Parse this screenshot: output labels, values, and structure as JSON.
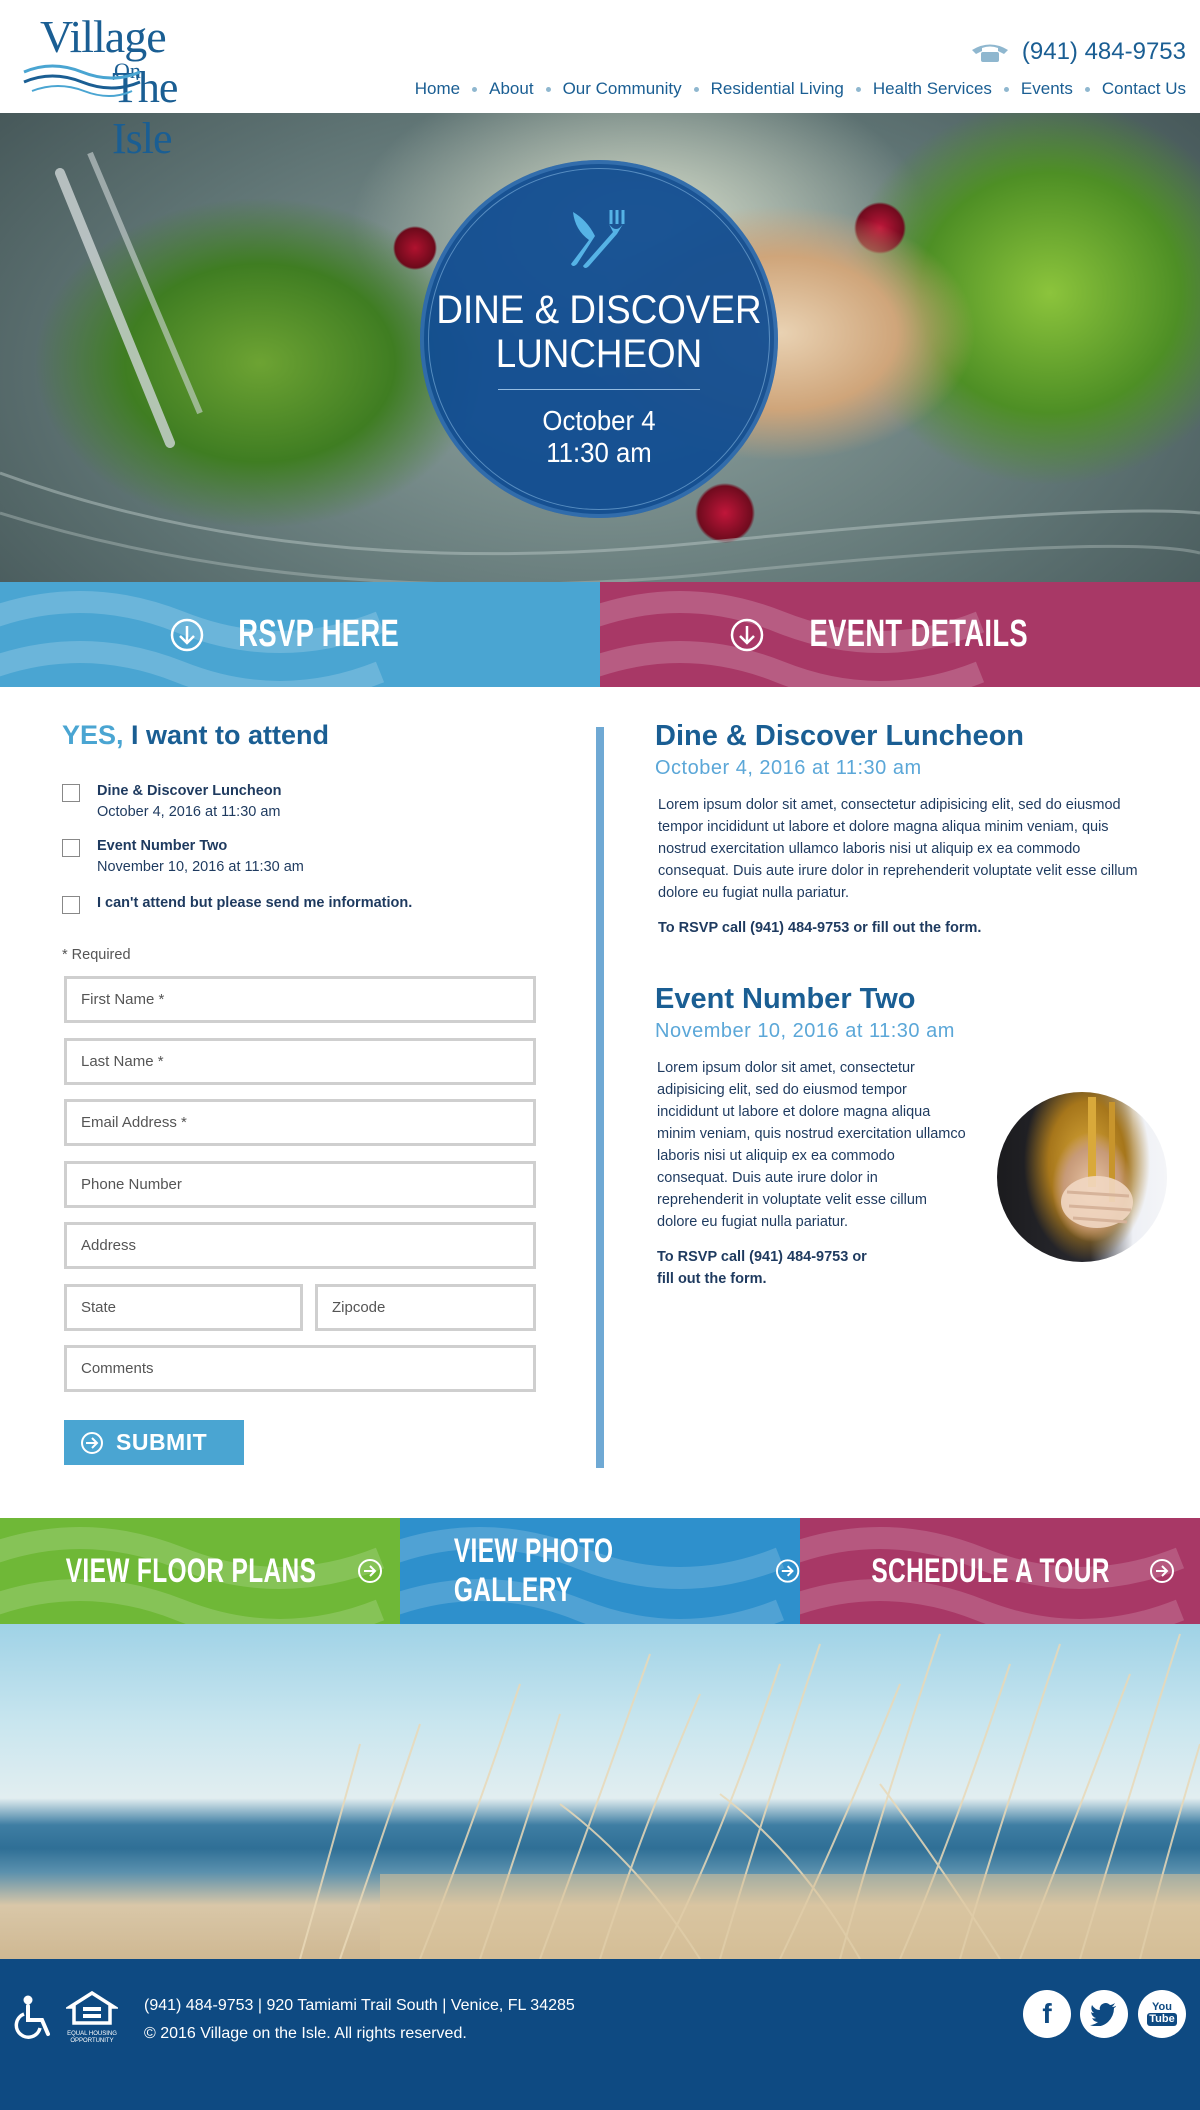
{
  "header": {
    "logo": {
      "line1": "Village",
      "line2": "On",
      "line3": "The Isle"
    },
    "phone": "(941) 484-9753",
    "nav": [
      "Home",
      "About",
      "Our Community",
      "Residential Living",
      "Health Services",
      "Events",
      "Contact Us"
    ]
  },
  "hero": {
    "title_line1": "DINE & DISCOVER",
    "title_line2": "LUNCHEON",
    "date_line1": "October 4",
    "date_line2": "11:30 am"
  },
  "banners": {
    "rsvp": "RSVP HERE",
    "details": "EVENT DETAILS"
  },
  "form": {
    "title_yes": "YES,",
    "title_rest": " I want to attend",
    "options": [
      {
        "title": "Dine & Discover Luncheon",
        "date": "October 4, 2016 at 11:30 am"
      },
      {
        "title": "Event Number Two",
        "date": "November 10, 2016 at 11:30 am"
      },
      {
        "title": "I can't attend but please send me information.",
        "date": ""
      }
    ],
    "required_note": "* Required",
    "placeholders": {
      "first_name": "First Name *",
      "last_name": "Last Name *",
      "email": "Email Address  *",
      "phone": "Phone Number",
      "address": "Address",
      "state": "State",
      "zipcode": "Zipcode",
      "comments": "Comments"
    },
    "submit": "SUBMIT"
  },
  "events": [
    {
      "title": "Dine & Discover Luncheon",
      "date": "October 4, 2016 at 11:30 am",
      "body": "Lorem ipsum dolor sit amet, consectetur adipisicing elit, sed do eiusmod tempor incididunt ut labore et dolore magna aliqua minim veniam, quis nostrud exercitation ullamco laboris nisi ut aliquip ex ea commodo consequat. Duis aute irure dolor in reprehenderit voluptate velit esse cillum dolore eu fugiat nulla pariatur.",
      "cta": "To RSVP call (941) 484-9753 or fill out the form."
    },
    {
      "title": "Event Number Two",
      "date": "November 10, 2016 at 11:30 am",
      "body": "Lorem ipsum dolor sit amet, consectetur adipisicing elit, sed do eiusmod tempor incididunt ut labore et dolore magna aliqua minim veniam, quis nostrud exercitation ullamco laboris nisi ut aliquip ex ea commodo consequat. Duis aute irure dolor in reprehenderit in voluptate velit esse cillum dolore eu fugiat nulla pariatur.",
      "cta": "To RSVP call (941) 484-9753 or fill out the form."
    }
  ],
  "cta_strip": [
    "VIEW FLOOR PLANS",
    "VIEW PHOTO GALLERY",
    "SCHEDULE A TOUR"
  ],
  "footer": {
    "line1": "(941) 484-9753 | 920 Tamiami Trail South | Venice, FL 34285",
    "line2": "© 2016 Village on the Isle. All rights reserved.",
    "eho_label": "EQUAL HOUSING OPPORTUNITY",
    "social": {
      "facebook": "f",
      "twitter": "t",
      "youtube_top": "You",
      "youtube_bottom": "Tube"
    }
  },
  "colors": {
    "brand_blue": "#1a5e93",
    "light_blue": "#4aa5d2",
    "magenta": "#a83866",
    "green": "#6fb837",
    "mid_blue": "#2e90cc",
    "footer_navy": "#0e4a82"
  }
}
